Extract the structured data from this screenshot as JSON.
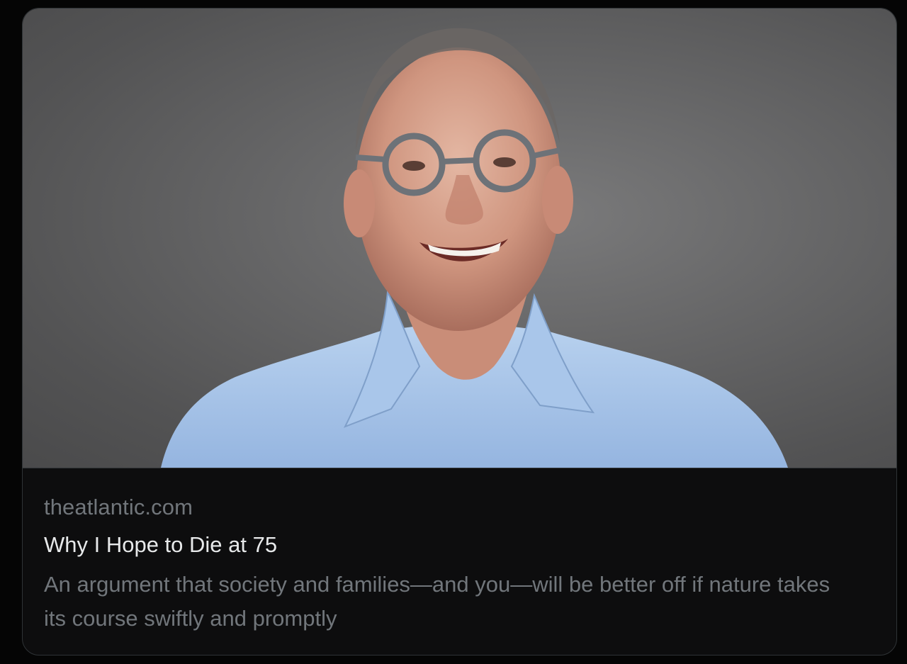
{
  "link_card": {
    "domain": "theatlantic.com",
    "title": "Why I Hope to Die at 75",
    "description": "An argument that society and families—and you—will be better off if nature takes its course swiftly and promptly"
  },
  "media": {
    "subject": "portrait-photo"
  },
  "colors": {
    "background": "#050505",
    "card_background": "#0d0d0e",
    "border": "#2f3336",
    "title_text": "#e7e9ea",
    "secondary_text": "#71767b"
  }
}
